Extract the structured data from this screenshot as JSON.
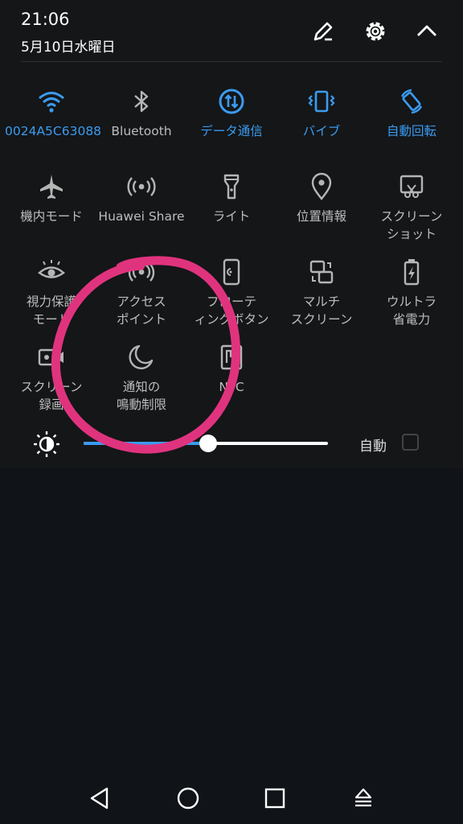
{
  "status": {
    "time": "21:06",
    "date": "5月10日水曜日"
  },
  "colors": {
    "accent": "#3b9bf0",
    "annotation": "#e0337e"
  },
  "tiles_row1": [
    {
      "label": "0024A5C63088",
      "icon": "wifi-icon",
      "active": true
    },
    {
      "label": "Bluetooth",
      "icon": "bluetooth-icon",
      "active": false
    },
    {
      "label": "データ通信",
      "icon": "mobile-data-icon",
      "active": true
    },
    {
      "label": "バイブ",
      "icon": "vibrate-icon",
      "active": true
    },
    {
      "label": "自動回転",
      "icon": "auto-rotate-icon",
      "active": true
    }
  ],
  "tiles_row2": [
    {
      "label": "機内モード",
      "icon": "airplane-icon"
    },
    {
      "label": "Huawei Share",
      "icon": "huawei-share-icon"
    },
    {
      "label": "ライト",
      "icon": "flashlight-icon"
    },
    {
      "label": "位置情報",
      "icon": "location-pin-icon"
    },
    {
      "label": "スクリーン\nショット",
      "icon": "screenshot-icon"
    }
  ],
  "tiles_row3": [
    {
      "label": "視力保護\nモード",
      "icon": "eye-icon"
    },
    {
      "label": "アクセス\nポイント",
      "icon": "hotspot-icon"
    },
    {
      "label": "フローテ\nィングボタン",
      "icon": "floating-button-icon"
    },
    {
      "label": "マルチ\nスクリーン",
      "icon": "multi-screen-icon"
    },
    {
      "label": "ウルトラ\n省電力",
      "icon": "ultra-power-icon"
    }
  ],
  "tiles_row4": [
    {
      "label": "スクリーン\n録画",
      "icon": "screen-record-icon"
    },
    {
      "label": "通知の\n鳴動制限",
      "icon": "moon-icon"
    },
    {
      "label": "NFC",
      "icon": "nfc-icon"
    }
  ],
  "brightness": {
    "auto_label": "自動",
    "level": 0.51,
    "auto_checked": false
  }
}
